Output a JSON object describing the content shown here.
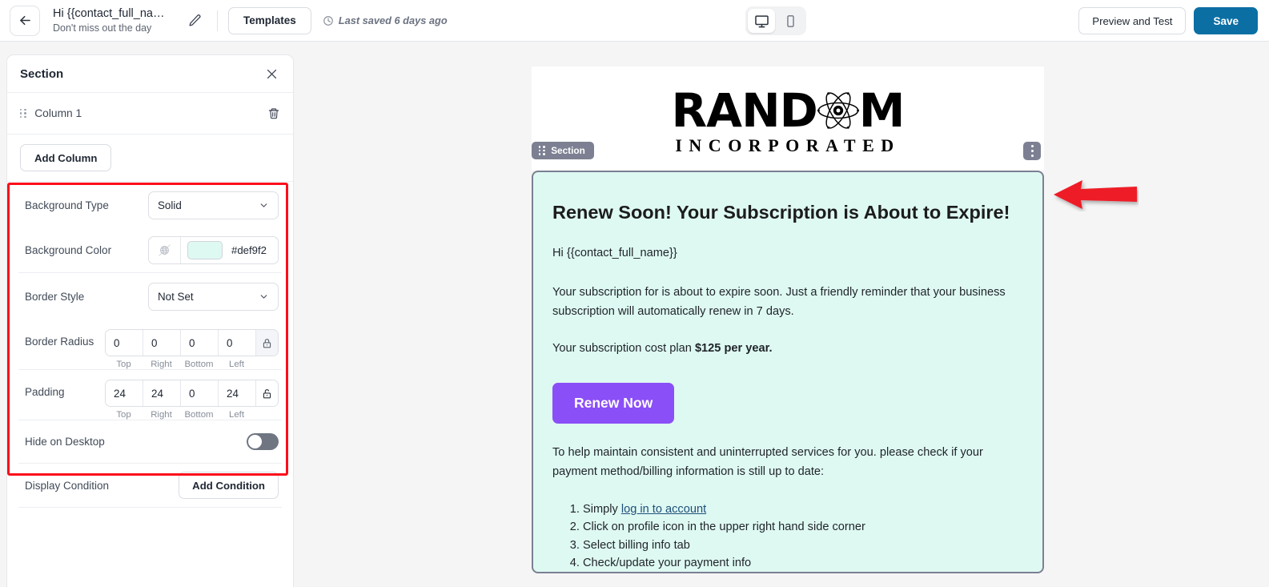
{
  "topbar": {
    "back_icon": "arrow-left-icon",
    "title": "Hi {{contact_full_na…",
    "subtitle": "Don't miss out the day",
    "edit_icon": "pencil-icon",
    "templates_label": "Templates",
    "clock_icon": "clock-icon",
    "saved_status": "Last saved 6 days ago",
    "device_desktop_icon": "desktop-monitor-icon",
    "device_mobile_icon": "mobile-phone-icon",
    "preview_label": "Preview and Test",
    "save_label": "Save",
    "save_color": "#0b6fa4"
  },
  "sidebar": {
    "panel_title": "Section",
    "close_icon": "close-x-icon",
    "column_label": "Column 1",
    "drag_icon": "drag-grip-icon",
    "delete_icon": "trash-icon",
    "add_column_label": "Add Column",
    "highlight_color": "#fc0d1b",
    "properties": {
      "background_type": {
        "label": "Background Type",
        "value": "Solid",
        "chevron_icon": "chevron-down-icon"
      },
      "background_color": {
        "label": "Background Color",
        "value": "#def9f2",
        "swatch_color": "#def9f2",
        "no_color_icon": "no-color-slash-icon"
      },
      "border_style": {
        "label": "Border Style",
        "value": "Not Set",
        "chevron_icon": "chevron-down-icon"
      },
      "border_radius": {
        "label": "Border Radius",
        "values": [
          "0",
          "0",
          "0",
          "0"
        ],
        "sides": [
          "Top",
          "Right",
          "Bottom",
          "Left"
        ],
        "lock_icon": "lock-closed-icon",
        "locked": true
      },
      "padding": {
        "label": "Padding",
        "values": [
          "24",
          "24",
          "0",
          "24"
        ],
        "sides": [
          "Top",
          "Right",
          "Bottom",
          "Left"
        ],
        "lock_icon": "lock-open-icon",
        "locked": false
      },
      "hide_on_desktop": {
        "label": "Hide on Desktop",
        "toggle_state": "off"
      },
      "display_condition": {
        "label": "Display Condition",
        "button_label": "Add Condition"
      }
    }
  },
  "email": {
    "logo": {
      "main_left": "RAND",
      "atom_icon": "atom-icon",
      "main_right": "M",
      "subtitle": "INCORPORATED"
    },
    "section_badge": {
      "label": "Section",
      "drag_icon": "drag-grip-icon",
      "kebab_icon": "kebab-menu-icon"
    },
    "background_color": "#def9f2",
    "heading_bold": "Renew Soon",
    "heading_rest": "! Your Subscription is About to Expire!",
    "greeting": "Hi {{contact_full_name}}",
    "paragraph1": "Your subscription for is about to expire soon. Just a friendly reminder that your business subscription will automatically renew in 7 days.",
    "cost_prefix": "Your subscription cost plan ",
    "cost_bold": "$125 per year.",
    "cta_label": "Renew Now",
    "cta_color": "#8b4ff7",
    "paragraph2": "To help maintain consistent and uninterrupted services for you. please check if your payment method/billing information is still up to date:",
    "steps": [
      {
        "pre": "Simply ",
        "link": "log in to account",
        "post": ""
      },
      {
        "pre": "Click on profile icon in the upper right hand side corner",
        "link": "",
        "post": ""
      },
      {
        "pre": "Select billing info tab",
        "link": "",
        "post": ""
      },
      {
        "pre": "Check/update your payment info",
        "link": "",
        "post": ""
      }
    ]
  },
  "annotation": {
    "arrow_icon": "red-arrow-left-icon",
    "arrow_color": "#ee1c25"
  }
}
